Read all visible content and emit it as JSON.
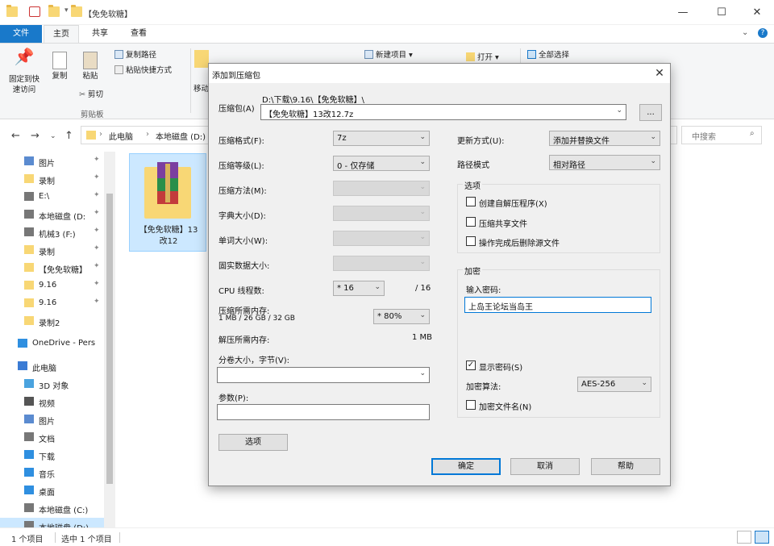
{
  "explorer": {
    "window_title": "【免免软糖】",
    "ribbon_tabs": [
      "文件",
      "主页",
      "共享",
      "查看"
    ],
    "ribbon": {
      "pin_label": "固定到快\n速访问",
      "copy_label": "复制",
      "paste_label": "粘贴",
      "copy_path": "复制路径",
      "paste_shortcut": "粘贴快捷方式",
      "cut": "剪切",
      "clipboard_group": "剪贴板",
      "move_label": "移动",
      "new_item": "新建项目",
      "open": "打开",
      "select_all": "全部选择"
    },
    "breadcrumb": [
      "此电脑",
      "本地磁盘 (D:)"
    ],
    "search_placeholder": "中搜索",
    "nav_items": [
      {
        "label": "图片",
        "pinned": true
      },
      {
        "label": "录制",
        "pinned": true
      },
      {
        "label": "E:\\",
        "pinned": true
      },
      {
        "label": "本地磁盘 (D:",
        "pinned": true
      },
      {
        "label": "机械3 (F:)",
        "pinned": true
      },
      {
        "label": "录制",
        "pinned": true
      },
      {
        "label": "【免免软糖】",
        "pinned": true
      },
      {
        "label": "9.16",
        "pinned": true
      },
      {
        "label": "9.16",
        "pinned": true
      },
      {
        "label": "录制2",
        "pinned": false
      },
      {
        "label": "OneDrive - Pers",
        "pinned": false
      },
      {
        "label": "此电脑",
        "pinned": false
      },
      {
        "label": "3D 对象",
        "pinned": false
      },
      {
        "label": "视频",
        "pinned": false
      },
      {
        "label": "图片",
        "pinned": false
      },
      {
        "label": "文档",
        "pinned": false
      },
      {
        "label": "下载",
        "pinned": false
      },
      {
        "label": "音乐",
        "pinned": false
      },
      {
        "label": "桌面",
        "pinned": false
      },
      {
        "label": "本地磁盘 (C:)",
        "pinned": false
      },
      {
        "label": "本地磁盘 (D:)",
        "pinned": false
      }
    ],
    "file_tile_label": "【免免软糖】13\n改12",
    "status_items": "1 个项目",
    "status_selected": "选中 1 个项目"
  },
  "dialog": {
    "title": "添加到压缩包",
    "archive_label": "压缩包(A)",
    "archive_path": "D:\\下载\\9.16\\【免免软糖】\\",
    "archive_name": "【免免软糖】13改12.7z",
    "browse_label": "...",
    "format_label": "压缩格式(F):",
    "format_value": "7z",
    "level_label": "压缩等级(L):",
    "level_value": "0 - 仅存储",
    "method_label": "压缩方法(M):",
    "dict_label": "字典大小(D):",
    "word_label": "单词大小(W):",
    "solid_label": "固实数据大小:",
    "cpu_label": "CPU 线程数:",
    "cpu_value": "* 16",
    "cpu_max": "/ 16",
    "mem_label": "压缩所需内存:",
    "mem_detail": "1 MB / 26 GB / 32 GB",
    "mem_value": "* 80%",
    "decomp_label": "解压所需内存:",
    "decomp_value": "1 MB",
    "split_label": "分卷大小，字节(V):",
    "split_value": "",
    "params_label": "参数(P):",
    "params_value": "",
    "options_button": "选项",
    "update_label": "更新方式(U):",
    "update_value": "添加并替换文件",
    "path_label": "路径模式",
    "path_value": "相对路径",
    "options_group": "选项",
    "opt_sfx": "创建自解压程序(X)",
    "opt_shared": "压缩共享文件",
    "opt_delete": "操作完成后删除源文件",
    "encrypt_group": "加密",
    "password_label": "输入密码:",
    "password_value": "上岛王论坛当岛王",
    "show_password": "显示密码(S)",
    "enc_method_label": "加密算法:",
    "enc_method_value": "AES-256",
    "encrypt_names": "加密文件名(N)",
    "ok": "确定",
    "cancel": "取消",
    "help": "帮助"
  }
}
